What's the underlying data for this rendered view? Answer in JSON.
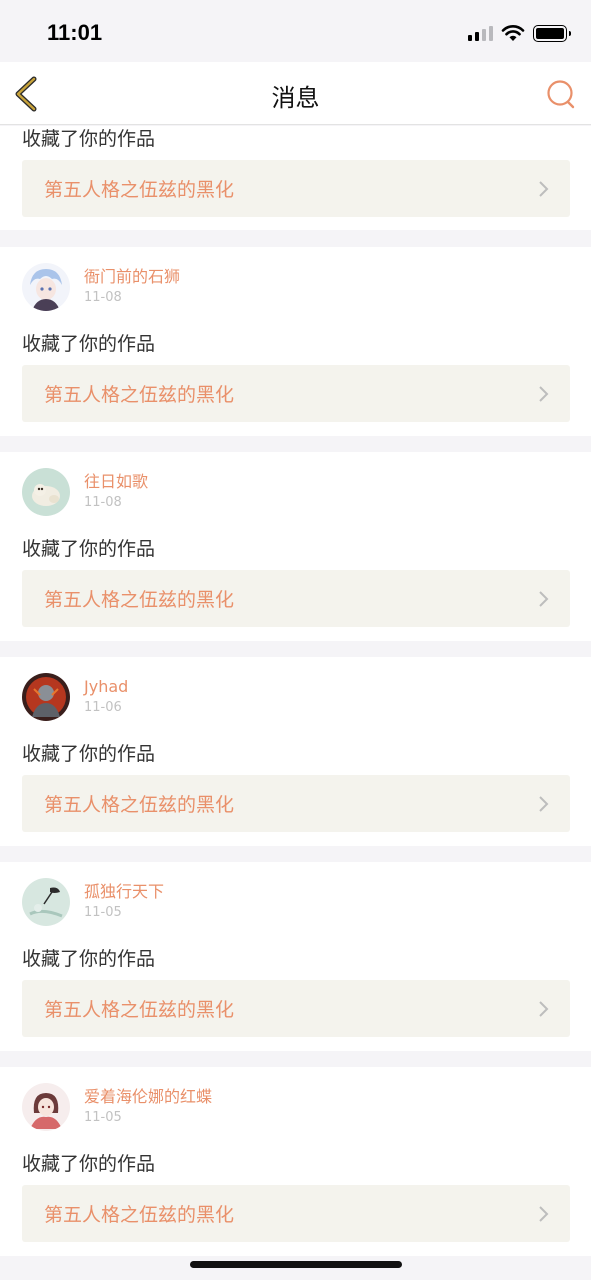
{
  "status": {
    "time": "11:01"
  },
  "nav": {
    "title": "消息"
  },
  "colors": {
    "accent": "#e9906a",
    "back_icon": "#c8a33a",
    "card_bg": "#f4f3ed"
  },
  "feed": {
    "top_card": {
      "action": "收藏了你的作品",
      "work": "第五人格之伍兹的黑化"
    },
    "items": [
      {
        "username": "衙门前的石狮",
        "date": "11-08",
        "action": "收藏了你的作品",
        "work": "第五人格之伍兹的黑化"
      },
      {
        "username": "往日如歌",
        "date": "11-08",
        "action": "收藏了你的作品",
        "work": "第五人格之伍兹的黑化"
      },
      {
        "username": "Jyhad",
        "date": "11-06",
        "action": "收藏了你的作品",
        "work": "第五人格之伍兹的黑化"
      },
      {
        "username": "孤独行天下",
        "date": "11-05",
        "action": "收藏了你的作品",
        "work": "第五人格之伍兹的黑化"
      },
      {
        "username": "爱着海伦娜的红蝶",
        "date": "11-05",
        "action": "收藏了你的作品",
        "work": "第五人格之伍兹的黑化"
      }
    ]
  }
}
